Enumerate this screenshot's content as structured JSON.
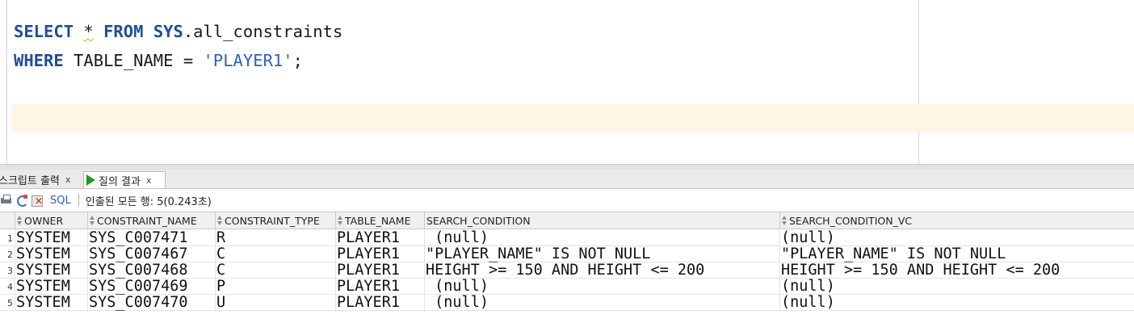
{
  "editor": {
    "line1": {
      "kw1": "SELECT",
      "sp1": " ",
      "star": "*",
      "sp2": " ",
      "kw2": "FROM",
      "sp3": " ",
      "kw3": "SYS",
      "rest": ".all_constraints"
    },
    "line2": {
      "kw1": "WHERE",
      "mid": " TABLE_NAME = ",
      "str": "'PLAYER1'",
      "end": ";"
    }
  },
  "tabs": [
    {
      "label": "스크립트 출력",
      "close": "x"
    },
    {
      "label": "질의 결과",
      "close": "x"
    }
  ],
  "toolbar": {
    "sql_label": "SQL",
    "status": "인출된 모든 행: 5(0.243초)"
  },
  "grid": {
    "columns": [
      "OWNER",
      "CONSTRAINT_NAME",
      "CONSTRAINT_TYPE",
      "TABLE_NAME",
      "SEARCH_CONDITION",
      "SEARCH_CONDITION_VC"
    ],
    "rows": [
      {
        "num": "1",
        "owner": "SYSTEM",
        "constraint_name": "SYS_C007471",
        "constraint_type": "R",
        "table_name": "PLAYER1",
        "search_condition": " (null)",
        "search_condition_vc": "(null)"
      },
      {
        "num": "2",
        "owner": "SYSTEM",
        "constraint_name": "SYS_C007467",
        "constraint_type": "C",
        "table_name": "PLAYER1",
        "search_condition": "\"PLAYER_NAME\" IS NOT NULL",
        "search_condition_vc": "\"PLAYER_NAME\" IS NOT NULL"
      },
      {
        "num": "3",
        "owner": "SYSTEM",
        "constraint_name": "SYS_C007468",
        "constraint_type": "C",
        "table_name": "PLAYER1",
        "search_condition": "HEIGHT >= 150 AND HEIGHT <= 200",
        "search_condition_vc": "HEIGHT >= 150 AND HEIGHT <= 200"
      },
      {
        "num": "4",
        "owner": "SYSTEM",
        "constraint_name": "SYS_C007469",
        "constraint_type": "P",
        "table_name": "PLAYER1",
        "search_condition": " (null)",
        "search_condition_vc": "(null)"
      },
      {
        "num": "5",
        "owner": "SYSTEM",
        "constraint_name": "SYS_C007470",
        "constraint_type": "U",
        "table_name": "PLAYER1",
        "search_condition": " (null)",
        "search_condition_vc": "(null)"
      }
    ]
  },
  "colors": {
    "keyword": "#1e4e96",
    "string": "#2f61b8",
    "current_line": "#fdf6e4",
    "run_icon": "#1f9a1f"
  }
}
